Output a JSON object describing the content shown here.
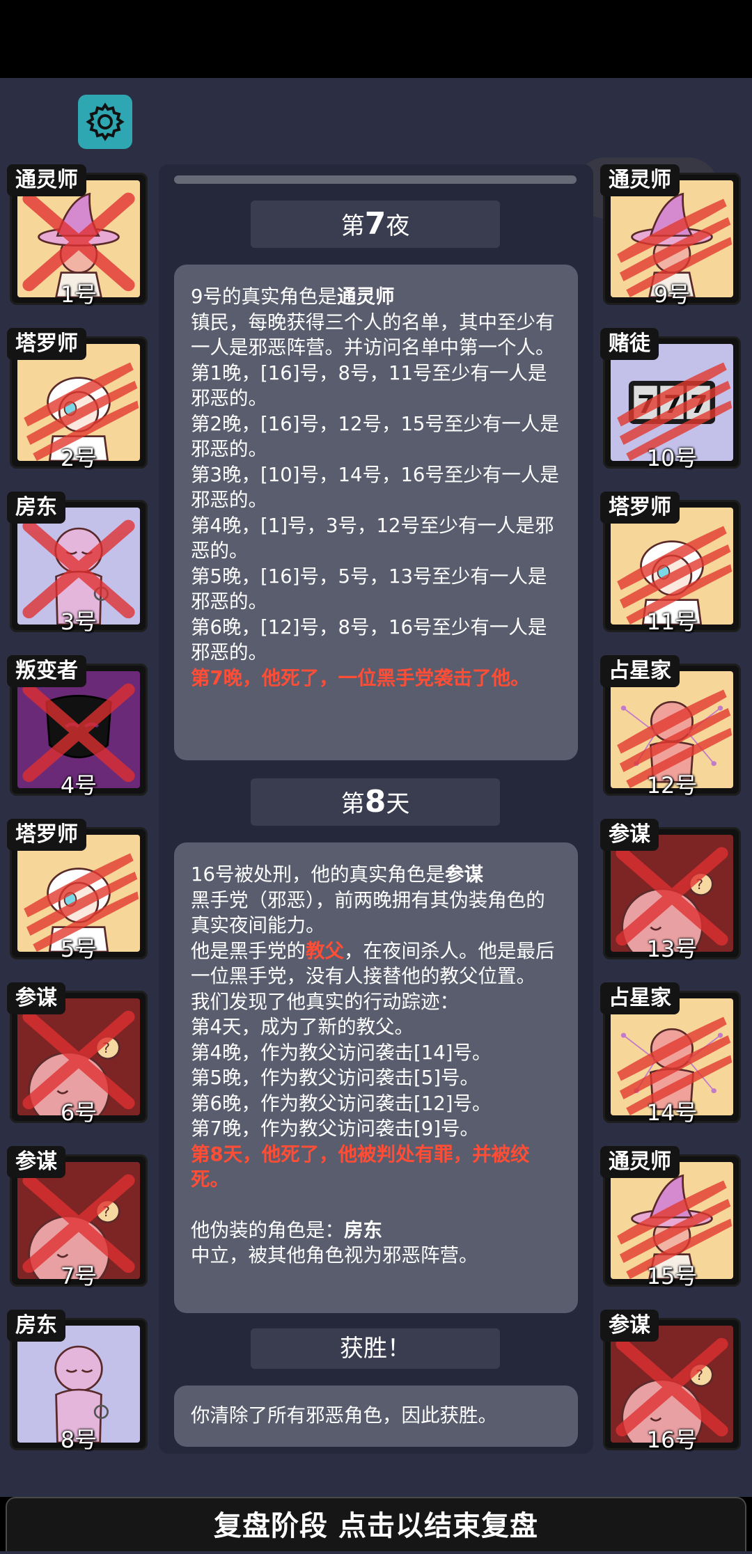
{
  "header": {
    "settings_icon": "gear-icon"
  },
  "mini_program": {
    "icons": [
      "more-dots-icon",
      "close-target-icon"
    ]
  },
  "left_players": [
    {
      "role": "通灵师",
      "number": "1号",
      "art": "medium",
      "bg": "#f7d69a",
      "mark": "x"
    },
    {
      "role": "塔罗师",
      "number": "2号",
      "art": "tarot",
      "bg": "#f7d69a",
      "mark": "claw"
    },
    {
      "role": "房东",
      "number": "3号",
      "art": "landlord",
      "bg": "#c3c0ea",
      "mark": "x"
    },
    {
      "role": "叛变者",
      "number": "4号",
      "art": "traitor",
      "bg": "#6b2a78",
      "mark": "x"
    },
    {
      "role": "塔罗师",
      "number": "5号",
      "art": "tarot",
      "bg": "#f7d69a",
      "mark": "claw"
    },
    {
      "role": "参谋",
      "number": "6号",
      "art": "advisor",
      "bg": "#7d2424",
      "mark": "x"
    },
    {
      "role": "参谋",
      "number": "7号",
      "art": "advisor",
      "bg": "#7d2424",
      "mark": "x"
    },
    {
      "role": "房东",
      "number": "8号",
      "art": "landlord",
      "bg": "#c3c0ea",
      "mark": "none"
    }
  ],
  "right_players": [
    {
      "role": "通灵师",
      "number": "9号",
      "art": "medium",
      "bg": "#f7d69a",
      "mark": "claw"
    },
    {
      "role": "赌徒",
      "number": "10号",
      "art": "gambler",
      "bg": "#c3c0ea",
      "mark": "claw"
    },
    {
      "role": "塔罗师",
      "number": "11号",
      "art": "tarot",
      "bg": "#f7d69a",
      "mark": "claw"
    },
    {
      "role": "占星家",
      "number": "12号",
      "art": "astro",
      "bg": "#f7d69a",
      "mark": "claw"
    },
    {
      "role": "参谋",
      "number": "13号",
      "art": "advisor",
      "bg": "#7d2424",
      "mark": "x"
    },
    {
      "role": "占星家",
      "number": "14号",
      "art": "astro",
      "bg": "#f7d69a",
      "mark": "claw"
    },
    {
      "role": "通灵师",
      "number": "15号",
      "art": "medium",
      "bg": "#f7d69a",
      "mark": "claw"
    },
    {
      "role": "参谋",
      "number": "16号",
      "art": "advisor",
      "bg": "#7d2424",
      "mark": "x"
    }
  ],
  "night7": {
    "head_pre": "第",
    "head_num": "7",
    "head_post": "夜",
    "intro_pre": "9号的真实角色是",
    "intro_role": "通灵师",
    "desc": "镇民，每晚获得三个人的名单，其中至少有一人是邪恶阵营。并访问名单中第一个人。",
    "lines": [
      "第1晚，[16]号，8号，11号至少有一人是邪恶的。",
      "第2晚，[16]号，12号，15号至少有一人是邪恶的。",
      "第3晚，[10]号，14号，16号至少有一人是邪恶的。",
      "第4晚，[1]号，3号，12号至少有一人是邪恶的。",
      "第5晚，[16]号，5号，13号至少有一人是邪恶的。",
      "第6晚，[12]号，8号，16号至少有一人是邪恶的。"
    ],
    "death": "第7晚，他死了，一位黑手党袭击了他。"
  },
  "day8": {
    "head_pre": "第",
    "head_num": "8",
    "head_post": "天",
    "intro_pre": "16号被处刑，他的真实角色是",
    "intro_role": "参谋",
    "desc": "黑手党（邪恶），前两晚拥有其伪装角色的真实夜间能力。",
    "godfather_pre": "他是黑手党的",
    "godfather": "教父",
    "godfather_post": "，在夜间杀人。他是最后一位黑手党，没有人接替他的教父位置。",
    "track_intro": "我们发现了他真实的行动踪迹：",
    "lines": [
      "第4天，成为了新的教父。",
      "第4晚，作为教父访问袭击[14]号。",
      "第5晚，作为教父访问袭击[5]号。",
      "第6晚，作为教父访问袭击[12]号。",
      "第7晚，作为教父访问袭击[9]号。"
    ],
    "death": "第8天，他死了，他被判处有罪，并被绞死。",
    "disguise_pre": "他伪装的角色是：",
    "disguise_role": "房东",
    "disguise_desc": "中立，被其他角色视为邪恶阵营。"
  },
  "victory": {
    "head": "获胜！",
    "text": "你清除了所有邪恶角色，因此获胜。"
  },
  "footer": {
    "label": "复盘阶段 点击以结束复盘"
  }
}
